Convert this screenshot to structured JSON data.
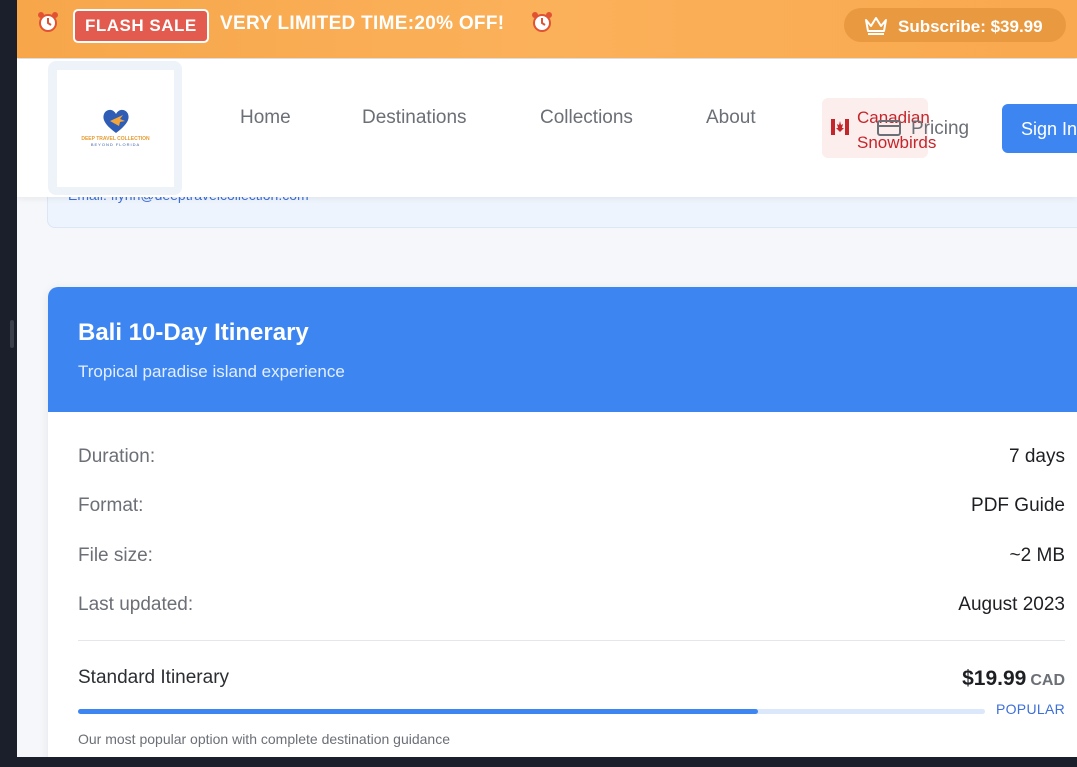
{
  "banner": {
    "alarm_icon": "alarm-clock-icon",
    "flash_label": "FLASH SALE",
    "promo_text": "VERY LIMITED TIME:20% OFF!",
    "subscribe_label": "Subscribe: $39.99",
    "subscribe_icon": "crown-icon",
    "accent": "#f7a64a"
  },
  "logo": {
    "brand": "DEEP TRAVEL COLLECTION",
    "tagline": "BEYOND FLORIDA"
  },
  "nav": {
    "items": [
      {
        "label": "Home"
      },
      {
        "label": "Destinations"
      },
      {
        "label": "Collections"
      },
      {
        "label": "About"
      }
    ],
    "canadian_line1": "Canadian",
    "canadian_line2": "Snowbirds",
    "pricing_label": "Pricing",
    "pricing_icon": "credit-card-icon",
    "signin_label": "Sign In",
    "signin_color": "#3d86f2"
  },
  "contact": {
    "email_text": "Email: flynn@deeptravelcollection.com"
  },
  "itinerary": {
    "title": "Bali 10-Day Itinerary",
    "subtitle": "Tropical paradise island experience",
    "details": [
      {
        "key": "Duration:",
        "value": "7 days"
      },
      {
        "key": "Format:",
        "value": "PDF Guide"
      },
      {
        "key": "File size:",
        "value": "~2 MB"
      },
      {
        "key": "Last updated:",
        "value": "August 2023"
      }
    ],
    "plan": {
      "name": "Standard Itinerary",
      "price": "$19.99",
      "currency": "CAD",
      "badge": "POPULAR",
      "popularity_fraction": 0.75,
      "description": "Our most popular option with complete destination guidance"
    }
  }
}
